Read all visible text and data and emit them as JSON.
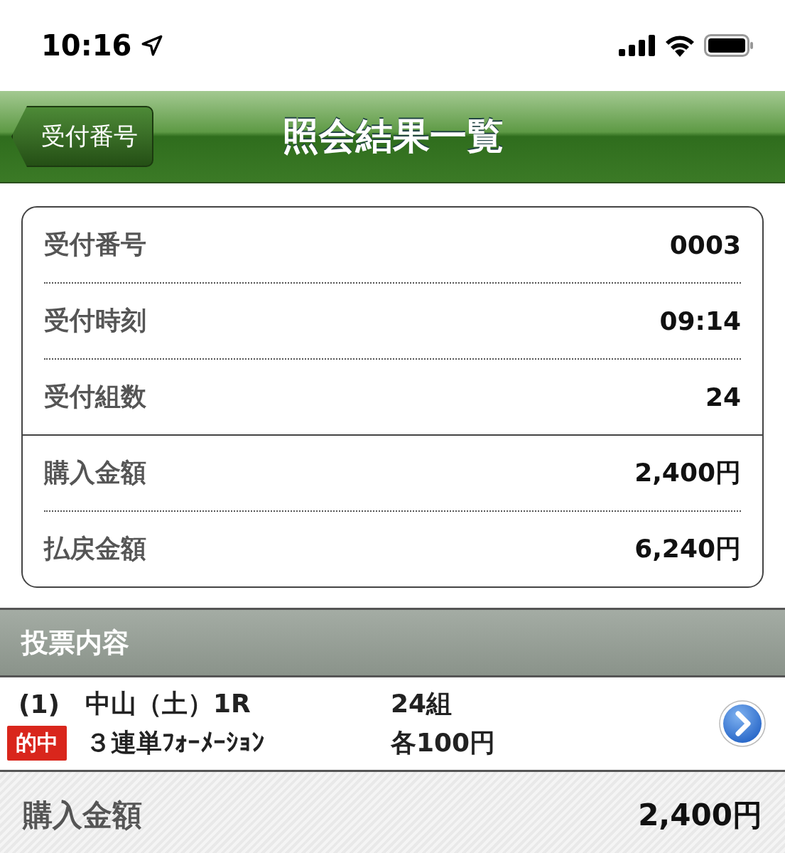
{
  "status_bar": {
    "time": "10:16"
  },
  "nav": {
    "back": "受付番号",
    "title": "照会結果一覧"
  },
  "summary": {
    "groups": [
      [
        {
          "label": "受付番号",
          "value": "0003"
        },
        {
          "label": "受付時刻",
          "value": "09:14"
        },
        {
          "label": "受付組数",
          "value": "24"
        }
      ],
      [
        {
          "label": "購入金額",
          "value": "2,400円"
        },
        {
          "label": "払戻金額",
          "value": "6,240円"
        }
      ]
    ]
  },
  "section": {
    "title": "投票内容"
  },
  "bets": [
    {
      "number": "(1)",
      "race": "中山（土）1R",
      "badge": "的中",
      "bet_type": "３連単ﾌｫｰﾒｰｼｮﾝ",
      "combos": "24組",
      "unit": "各100円"
    }
  ],
  "total": {
    "label": "購入金額",
    "value": "2,400円"
  }
}
